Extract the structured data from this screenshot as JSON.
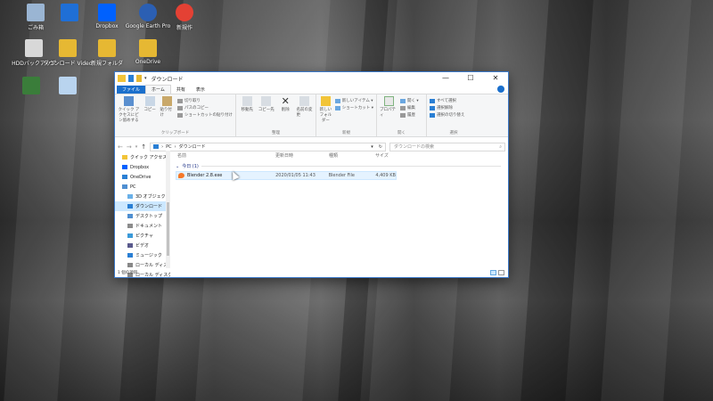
{
  "desktop": {
    "icons": [
      {
        "label": "ごみ箱",
        "color": "#9ab5d3"
      },
      {
        "label": "",
        "color": "#1f6fd6"
      },
      {
        "label": "Dropbox",
        "color": "#0061fe"
      },
      {
        "label": "Google Earth Pro",
        "color": "#2b5fb3"
      },
      {
        "label": "新規作",
        "color": "#e44134"
      },
      {
        "label": "HDDバックアップ",
        "color": "#d8d8d8"
      },
      {
        "label": "ダウンロード Video",
        "color": "#e6b833"
      },
      {
        "label": "新規フォルダ",
        "color": "#e6b833"
      },
      {
        "label": "OneDrive",
        "color": "#e6b833"
      },
      {
        "label": "",
        "color": "#3a7d3a"
      },
      {
        "label": "",
        "color": "#b9d4ef"
      }
    ]
  },
  "window": {
    "title": "ダウンロード",
    "controls": {
      "minimize": "—",
      "maximize": "☐",
      "close": "✕"
    },
    "tabs": [
      "ファイル",
      "ホーム",
      "共有",
      "表示"
    ],
    "active_tab_index": 1,
    "ribbon": {
      "clipboard": {
        "label": "クリップボード",
        "pin": "クイック アクセスにピン留めする",
        "copy": "コピー",
        "paste": "貼り付け",
        "cut": "切り取り",
        "copy_path": "パスのコピー",
        "paste_shortcut": "ショートカットの貼り付け"
      },
      "organize": {
        "label": "整理",
        "move_to": "移動先",
        "copy_to": "コピー先",
        "delete": "削除",
        "rename": "名前の変更"
      },
      "new": {
        "label": "新規",
        "new_folder": "新しいフォルダー",
        "new_item": "新しいアイテム ▾",
        "shortcut": "ショートカット ▾"
      },
      "open": {
        "label": "開く",
        "properties": "プロパティ",
        "open": "開く ▾",
        "edit": "編集",
        "history": "履歴"
      },
      "select": {
        "label": "選択",
        "select_all": "すべて選択",
        "select_none": "選択解除",
        "invert": "選択の切り替え"
      }
    },
    "address": {
      "root": "PC",
      "folder": "ダウンロード",
      "search_placeholder": "ダウンロードの検索"
    },
    "nav": [
      {
        "label": "クイック アクセス",
        "color": "#f2c438",
        "child": false
      },
      {
        "label": "Dropbox",
        "color": "#0061fe",
        "child": false
      },
      {
        "label": "OneDrive",
        "color": "#2a7fd4",
        "child": false
      },
      {
        "label": "PC",
        "color": "#4f8fd1",
        "child": false
      },
      {
        "label": "3D オブジェクト",
        "color": "#6ab0e8",
        "child": true
      },
      {
        "label": "ダウンロード",
        "color": "#2a7fd4",
        "child": true
      },
      {
        "label": "デスクトップ",
        "color": "#4f8fd1",
        "child": true
      },
      {
        "label": "ドキュメント",
        "color": "#8c8c8c",
        "child": true
      },
      {
        "label": "ピクチャ",
        "color": "#3b9ad9",
        "child": true
      },
      {
        "label": "ビデオ",
        "color": "#5a5a8c",
        "child": true
      },
      {
        "label": "ミュージック",
        "color": "#2a7fd4",
        "child": true
      },
      {
        "label": "ローカル ディスク (C",
        "color": "#888888",
        "child": true
      },
      {
        "label": "ローカル ディスク (C",
        "color": "#888888",
        "child": true
      }
    ],
    "selected_nav_index": 5,
    "columns": [
      "名前",
      "更新日時",
      "種類",
      "サイズ"
    ],
    "group": {
      "label": "今日 (1)"
    },
    "files": [
      {
        "name": "Blender 2.8.exe",
        "modified": "2020/01/05 11:43",
        "type": "Blender File",
        "size": "4,409 KB"
      }
    ],
    "status": "1 個の項目"
  }
}
